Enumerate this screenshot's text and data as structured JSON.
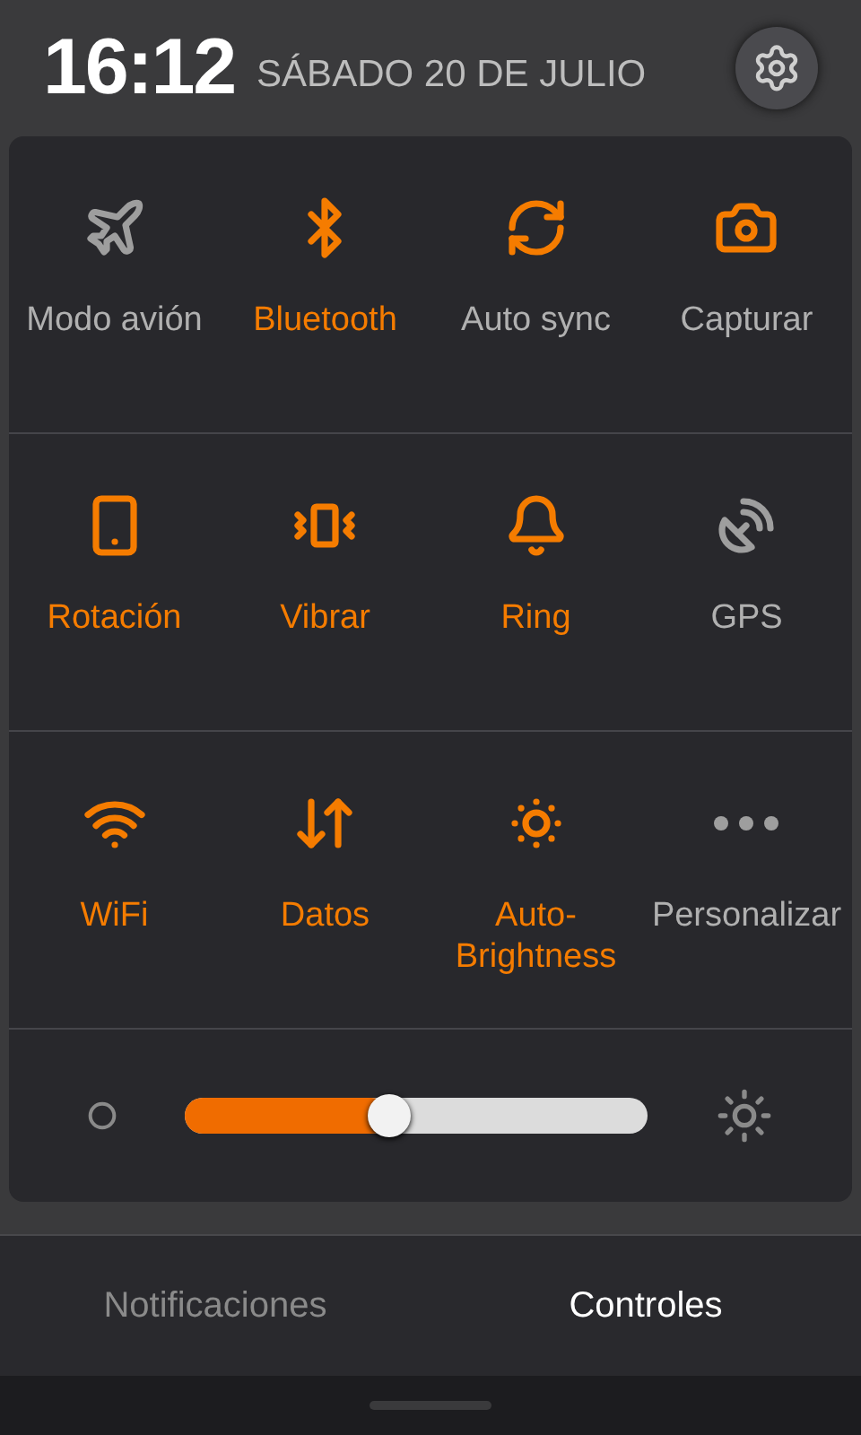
{
  "header": {
    "time": "16:12",
    "date": "SÁBADO 20 DE JULIO"
  },
  "toggles": [
    {
      "label": "Modo avión",
      "on": false,
      "icon_on": false
    },
    {
      "label": "Bluetooth",
      "on": true,
      "icon_on": true
    },
    {
      "label": "Auto sync",
      "on": false,
      "icon_on": true
    },
    {
      "label": "Capturar",
      "on": false,
      "icon_on": true
    },
    {
      "label": "Rotación",
      "on": true,
      "icon_on": true
    },
    {
      "label": "Vibrar",
      "on": true,
      "icon_on": true
    },
    {
      "label": "Ring",
      "on": true,
      "icon_on": true
    },
    {
      "label": "GPS",
      "on": false,
      "icon_on": false
    },
    {
      "label": "WiFi",
      "on": true,
      "icon_on": true
    },
    {
      "label": "Datos",
      "on": true,
      "icon_on": true
    },
    {
      "label": "Auto-\nBrightness",
      "on": true,
      "icon_on": true
    },
    {
      "label": "Personalizar",
      "on": false,
      "icon_on": false
    }
  ],
  "brightness": {
    "level": 0.44
  },
  "tabs": [
    {
      "label": "Notificaciones",
      "selected": false
    },
    {
      "label": "Controles",
      "selected": true
    }
  ]
}
